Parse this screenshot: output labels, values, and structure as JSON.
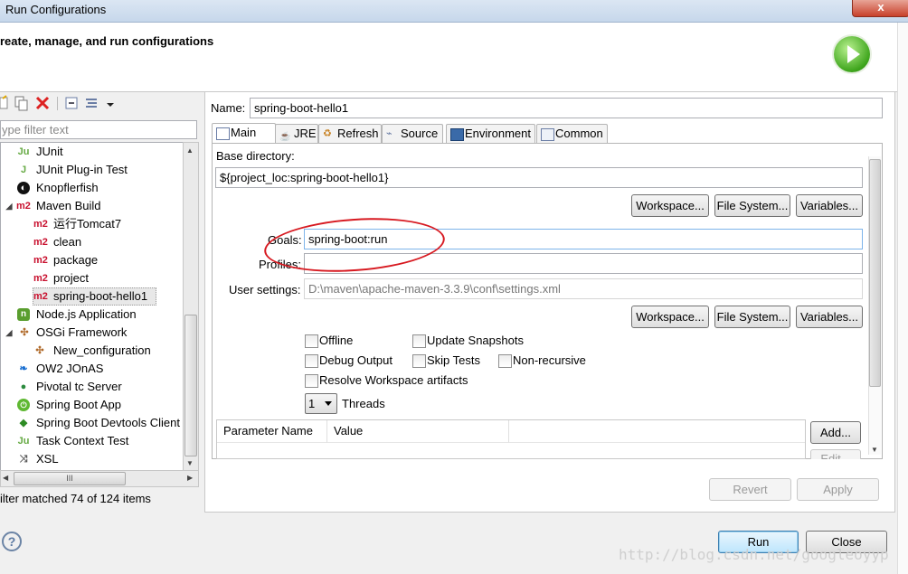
{
  "window": {
    "title": "Run Configurations",
    "close_glyph": "x"
  },
  "header": {
    "heading": "reate, manage, and run configurations",
    "icon": "run-launch-icon"
  },
  "left": {
    "filter_placeholder": "ype filter text",
    "tree": [
      {
        "label": "JUnit",
        "icon": "junit-icon",
        "indent": 0
      },
      {
        "label": "JUnit Plug-in Test",
        "icon": "junit-plugin-icon",
        "indent": 0
      },
      {
        "label": "Knopflerfish",
        "icon": "knopflerfish-icon",
        "indent": 0
      },
      {
        "label": "Maven Build",
        "icon": "maven-icon",
        "indent": 0,
        "expanded": true
      },
      {
        "label": "运行Tomcat7",
        "icon": "maven-icon",
        "indent": 1
      },
      {
        "label": "clean",
        "icon": "maven-icon",
        "indent": 1
      },
      {
        "label": "package",
        "icon": "maven-icon",
        "indent": 1
      },
      {
        "label": "project",
        "icon": "maven-icon",
        "indent": 1
      },
      {
        "label": "spring-boot-hello1",
        "icon": "maven-icon",
        "indent": 1,
        "selected": true
      },
      {
        "label": "Node.js Application",
        "icon": "nodejs-icon",
        "indent": 0
      },
      {
        "label": "OSGi Framework",
        "icon": "osgi-icon",
        "indent": 0,
        "expanded": true
      },
      {
        "label": "New_configuration",
        "icon": "osgi-icon",
        "indent": 1
      },
      {
        "label": "OW2 JOnAS",
        "icon": "jonas-icon",
        "indent": 0
      },
      {
        "label": "Pivotal tc Server",
        "icon": "pivotal-icon",
        "indent": 0
      },
      {
        "label": "Spring Boot App",
        "icon": "spring-icon",
        "indent": 0
      },
      {
        "label": "Spring Boot Devtools Client",
        "icon": "spring-devtools-icon",
        "indent": 0
      },
      {
        "label": "Task Context Test",
        "icon": "junit-task-icon",
        "indent": 0
      },
      {
        "label": "XSL",
        "icon": "xsl-icon",
        "indent": 0
      }
    ],
    "scroll_grip": "III",
    "status": "ilter matched 74 of 124 items",
    "help_glyph": "?"
  },
  "main": {
    "name_label": "Name:",
    "name_value": "spring-boot-hello1",
    "tabs": [
      {
        "label": "Main",
        "icon": "main-tab-icon"
      },
      {
        "label": "JRE",
        "icon": "jre-icon"
      },
      {
        "label": "Refresh",
        "icon": "refresh-icon"
      },
      {
        "label": "Source",
        "icon": "source-icon"
      },
      {
        "label": "Environment",
        "icon": "environment-icon"
      },
      {
        "label": "Common",
        "icon": "common-icon"
      }
    ],
    "base_dir_label": "Base directory:",
    "base_dir_value": "${project_loc:spring-boot-hello1}",
    "workspace_btn": "Workspace...",
    "filesystem_btn": "File System...",
    "variables_btn": "Variables...",
    "goals_label": "Goals:",
    "goals_value": "spring-boot:run",
    "profiles_label": "Profiles:",
    "profiles_value": "",
    "user_settings_label": "User settings:",
    "user_settings_value": "D:\\maven\\apache-maven-3.3.9\\conf\\settings.xml",
    "checkboxes": {
      "offline": "Offline",
      "update_snapshots": "Update Snapshots",
      "debug_output": "Debug Output",
      "skip_tests": "Skip Tests",
      "non_recursive": "Non-recursive",
      "resolve_workspace": "Resolve Workspace artifacts"
    },
    "threads_value": "1",
    "threads_label": "Threads",
    "param_table": {
      "columns": [
        "Parameter Name",
        "Value"
      ]
    },
    "add_btn": "Add...",
    "edit_btn": "Edit...",
    "revert_btn": "Revert",
    "apply_btn": "Apply"
  },
  "footer": {
    "run_btn": "Run",
    "close_btn": "Close",
    "watermark": "http://blog.csdn.net/googleoyyp"
  },
  "colors": {
    "annotation_ellipse": "#d71920",
    "maven_red": "#c8102e"
  }
}
